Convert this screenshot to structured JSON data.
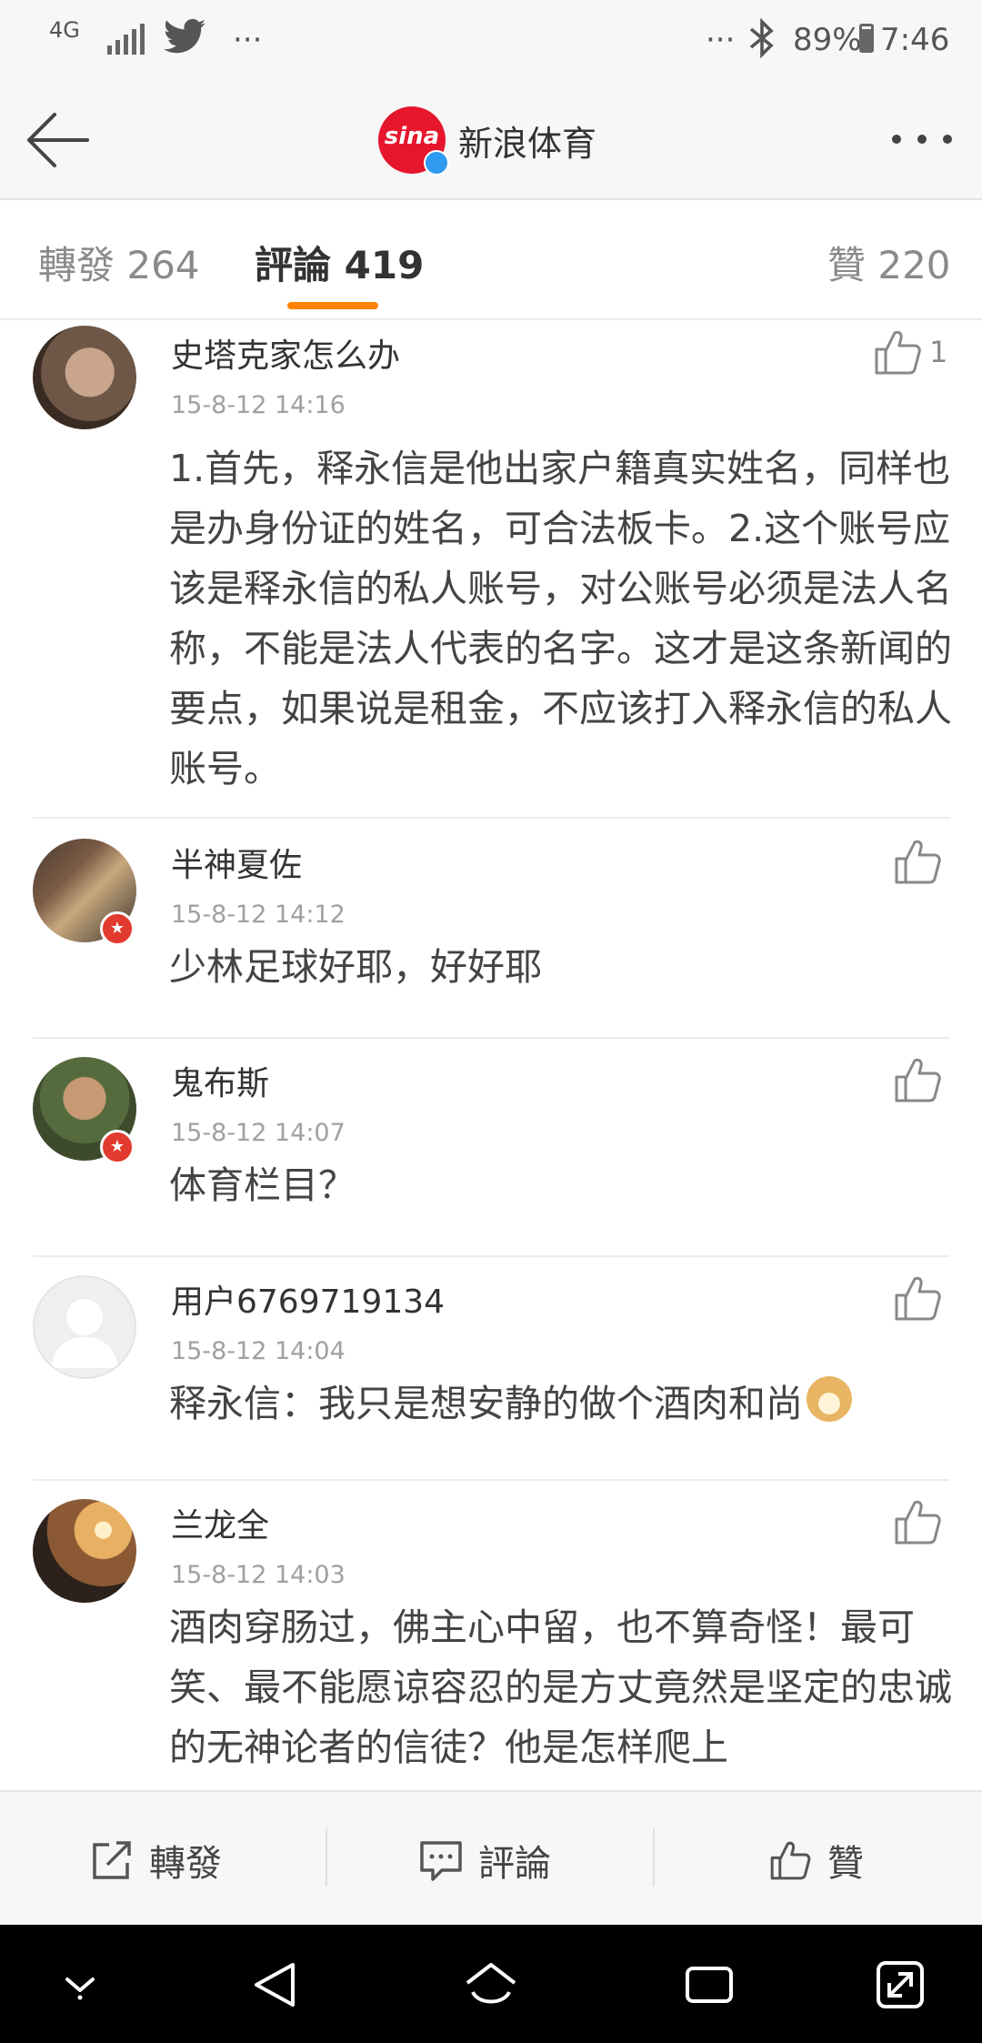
{
  "status_bar": {
    "network": "4G",
    "overflow_left": "···",
    "overflow_right": "···",
    "battery_percent": "89%",
    "time": "7:46"
  },
  "header": {
    "account_name": "新浪体育",
    "logo_text": "sina"
  },
  "tabs": {
    "repost": "轉發 264",
    "comment": "評論 419",
    "like": "贊 220"
  },
  "comments": [
    {
      "name": "史塔克家怎么办",
      "time": "15-8-12 14:16",
      "text": "1.首先，释永信是他出家户籍真实姓名，同样也是办身份证的姓名，可合法板卡。2.这个账号应该是释永信的私人账号，对公账号必须是法人名称，不能是法人代表的名字。这才是这条新闻的要点，如果说是租金，不应该打入释永信的私人账号。",
      "likes": "1"
    },
    {
      "name": "半神夏佐",
      "time": "15-8-12 14:12",
      "text": "少林足球好耶，好好耶"
    },
    {
      "name": "鬼布斯",
      "time": "15-8-12 14:07",
      "text": "体育栏目？"
    },
    {
      "name": "用户6769719134",
      "time": "15-8-12 14:04",
      "text": "释永信：我只是想安静的做个酒肉和尚"
    },
    {
      "name": "兰龙全",
      "time": "15-8-12 14:03",
      "text": "酒肉穿肠过，佛主心中留，也不算奇怪！最可笑、最不能愿谅容忍的是方丈竟然是坚定的忠诚的无神论者的信徒？他是怎样爬上"
    }
  ],
  "actions": {
    "repost": "轉發",
    "comment": "評論",
    "like": "贊"
  },
  "colors": {
    "accent": "#ff8200",
    "brand_red": "#e6162d",
    "badge_red": "#e23a2e",
    "verified_blue": "#2f9bf0"
  }
}
